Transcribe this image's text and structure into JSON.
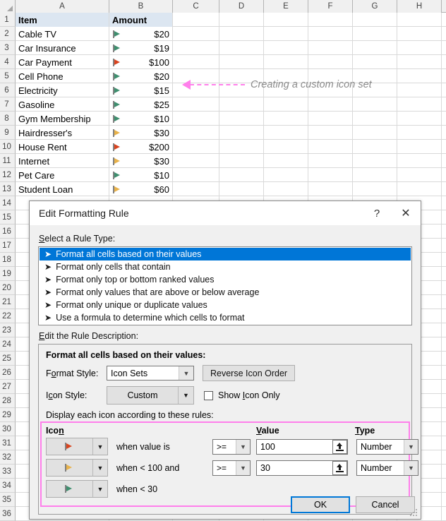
{
  "sheet": {
    "columns": [
      "A",
      "B",
      "C",
      "D",
      "E",
      "F",
      "G",
      "H"
    ],
    "row_numbers": [
      "1",
      "2",
      "3",
      "4",
      "5",
      "6",
      "7",
      "8",
      "9",
      "10",
      "11",
      "12",
      "13",
      "14",
      "15",
      "16",
      "17",
      "18",
      "19",
      "20",
      "21",
      "22",
      "23",
      "24",
      "25",
      "26",
      "27",
      "28",
      "29",
      "30",
      "31",
      "32",
      "33",
      "34",
      "35",
      "36"
    ],
    "header": {
      "item": "Item",
      "amount": "Amount"
    },
    "rows": [
      {
        "item": "Cable TV",
        "amount": "$20",
        "flag": "green"
      },
      {
        "item": "Car Insurance",
        "amount": "$19",
        "flag": "green"
      },
      {
        "item": "Car Payment",
        "amount": "$100",
        "flag": "red"
      },
      {
        "item": "Cell Phone",
        "amount": "$20",
        "flag": "green"
      },
      {
        "item": "Electricity",
        "amount": "$15",
        "flag": "green"
      },
      {
        "item": "Gasoline",
        "amount": "$25",
        "flag": "green"
      },
      {
        "item": "Gym Membership",
        "amount": "$10",
        "flag": "green"
      },
      {
        "item": "Hairdresser's",
        "amount": "$30",
        "flag": "yellow"
      },
      {
        "item": "House Rent",
        "amount": "$200",
        "flag": "red"
      },
      {
        "item": "Internet",
        "amount": "$30",
        "flag": "yellow"
      },
      {
        "item": "Pet Care",
        "amount": "$10",
        "flag": "green"
      },
      {
        "item": "Student Loan",
        "amount": "$60",
        "flag": "yellow"
      }
    ]
  },
  "annotation": {
    "text": "Creating a custom icon set",
    "color": "#ff7feb"
  },
  "dialog": {
    "title": "Edit Formatting Rule",
    "help_label": "?",
    "close_label": "✕",
    "rule_type_label": "Select a Rule Type:",
    "rule_types": [
      {
        "label": "Format all cells based on their values",
        "selected": true
      },
      {
        "label": "Format only cells that contain",
        "selected": false
      },
      {
        "label": "Format only top or bottom ranked values",
        "selected": false
      },
      {
        "label": "Format only values that are above or below average",
        "selected": false
      },
      {
        "label": "Format only unique or duplicate values",
        "selected": false
      },
      {
        "label": "Use a formula to determine which cells to format",
        "selected": false
      }
    ],
    "rule_desc_label": "Edit the Rule Description:",
    "desc_title": "Format all cells based on their values:",
    "format_style_label": "Format Style:",
    "format_style_value": "Icon Sets",
    "reverse_icon_order_label": "Reverse Icon Order",
    "icon_style_label": "Icon Style:",
    "icon_style_value": "Custom",
    "show_icon_only_label": "Show Icon Only",
    "show_icon_only_checked": false,
    "display_rules_label": "Display each icon according to these rules:",
    "icon_table": {
      "headers": {
        "icon": "Icon",
        "value": "Value",
        "type": "Type"
      },
      "rows": [
        {
          "flag": "red",
          "when": "when value is",
          "operator": ">=",
          "value": "100",
          "type": "Number"
        },
        {
          "flag": "yellow",
          "when": "when < 100 and",
          "operator": ">=",
          "value": "30",
          "type": "Number"
        },
        {
          "flag": "green",
          "when": "when < 30",
          "operator": "",
          "value": "",
          "type": ""
        }
      ]
    },
    "ok_label": "OK",
    "cancel_label": "Cancel"
  }
}
